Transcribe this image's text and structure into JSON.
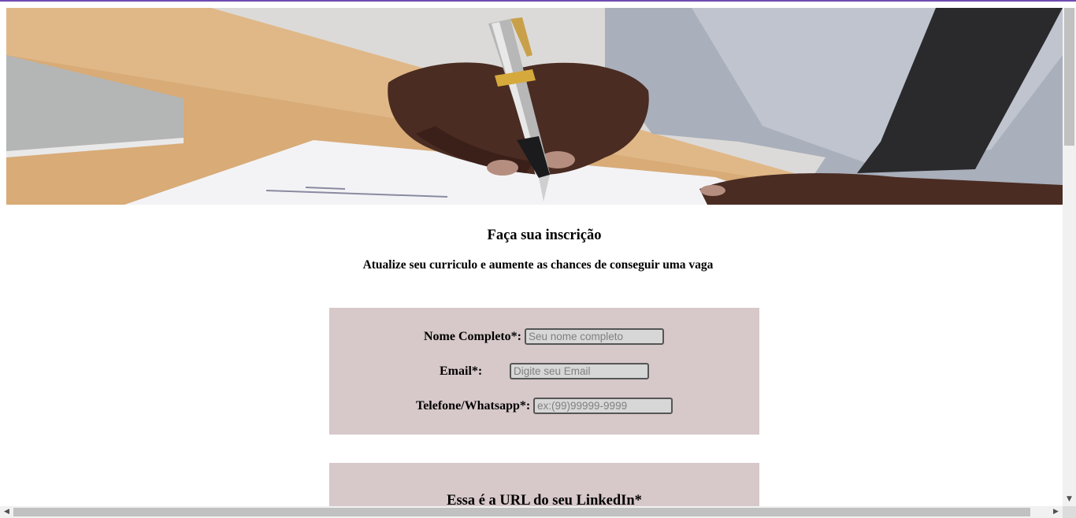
{
  "page": {
    "title": "Faça sua inscrição",
    "subtitle": "Atualize seu curriculo e aumente as chances de conseguir uma vaga"
  },
  "form": {
    "fields": [
      {
        "label": "Nome Completo*:",
        "placeholder": "Seu nome completo",
        "value": ""
      },
      {
        "label": "Email*:",
        "placeholder": "Digite seu Email",
        "value": ""
      },
      {
        "label": "Telefone/Whatsapp*:",
        "placeholder": "ex:(99)99999-9999",
        "value": ""
      }
    ],
    "linkedin_heading": "Essa é a URL do seu LinkedIn*"
  },
  "icons": {
    "scroll_down": "triangle-down-icon",
    "scroll_left": "triangle-left-icon",
    "scroll_right": "triangle-right-icon"
  },
  "colors": {
    "accent_top": "#6f4bb0",
    "panel_background": "#d7c8c9",
    "input_background": "#d7d7d7"
  }
}
